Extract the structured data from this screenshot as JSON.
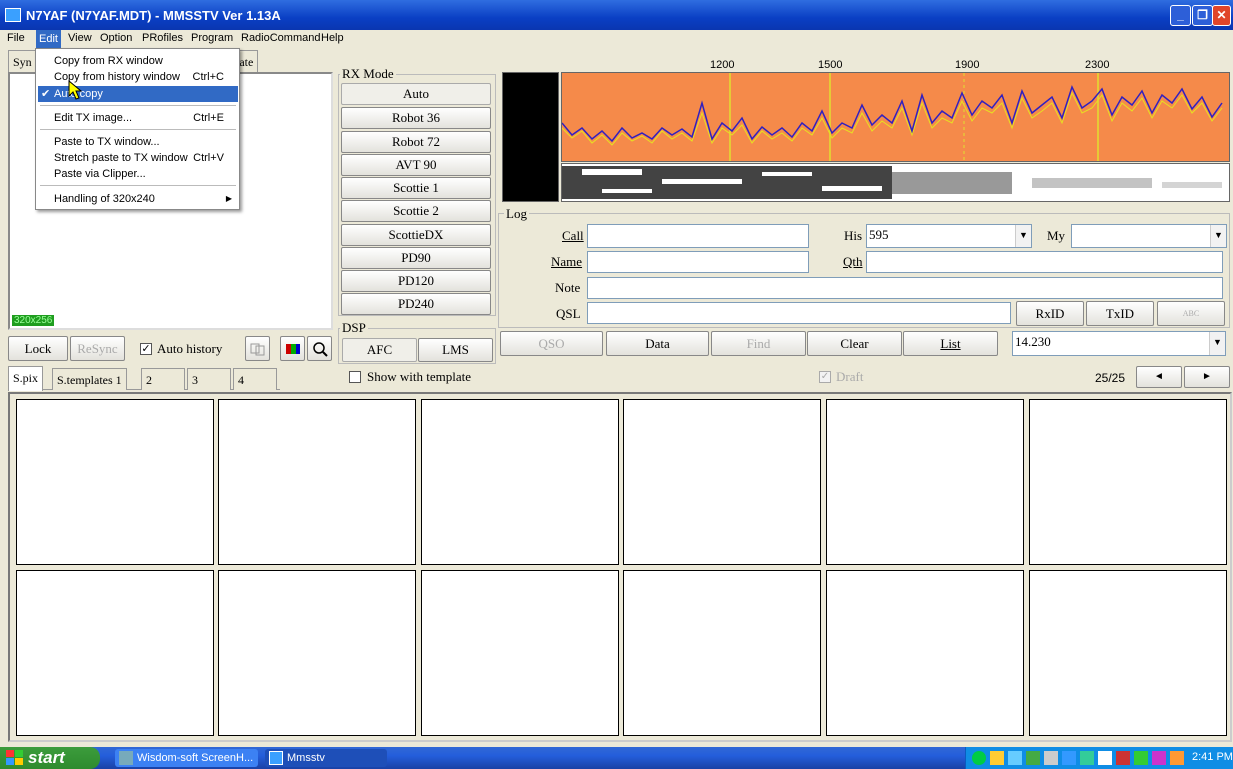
{
  "window": {
    "title": "N7YAF (N7YAF.MDT) - MMSSTV Ver 1.13A"
  },
  "menubar": [
    "File",
    "Edit",
    "View",
    "Option",
    "PRofiles",
    "Program",
    "RadioCommand",
    "Help"
  ],
  "edit_menu": {
    "items": [
      {
        "label": "Copy from RX window",
        "shortcut": ""
      },
      {
        "label": "Copy from history window",
        "shortcut": "Ctrl+C"
      },
      {
        "label": "Auto copy",
        "shortcut": "",
        "checked": true
      },
      {
        "label": "Edit TX image...",
        "shortcut": "Ctrl+E"
      },
      {
        "label": "Paste to TX window...",
        "shortcut": ""
      },
      {
        "label": "Stretch paste to TX window",
        "shortcut": "Ctrl+V"
      },
      {
        "label": "Paste via Clipper...",
        "shortcut": ""
      },
      {
        "label": "Handling of 320x240",
        "shortcut": "",
        "submenu": true
      }
    ],
    "checkmark": "✔",
    "submenu_arrow": "▶"
  },
  "top_tabs": {
    "first": "Syn",
    "second": "late"
  },
  "rx_panel": {
    "size_badge": "320x256"
  },
  "rx_controls": {
    "lock": "Lock",
    "resync": "ReSync",
    "auto_history": "Auto history",
    "auto_history_checked": true,
    "check_glyph": "✓"
  },
  "rx_mode": {
    "label": "RX Mode",
    "modes": [
      "Auto",
      "Robot 36",
      "Robot 72",
      "AVT 90",
      "Scottie 1",
      "Scottie 2",
      "ScottieDX",
      "PD90",
      "PD120",
      "PD240"
    ]
  },
  "dsp": {
    "label": "DSP",
    "afc": "AFC",
    "lms": "LMS"
  },
  "spectrum": {
    "freq_labels": [
      "1200",
      "1500",
      "1900",
      "2300"
    ],
    "bg_color": "#f58a4a"
  },
  "log": {
    "label": "Log",
    "call_label": "Call",
    "call_value": "",
    "his_label": "His",
    "his_value": "595",
    "my_label": "My",
    "my_value": "",
    "name_label": "Name",
    "name_value": "",
    "qth_label": "Qth",
    "qth_value": "",
    "note_label": "Note",
    "note_value": "",
    "qsl_label": "QSL",
    "qsl_value": "",
    "rxid": "RxID",
    "txid": "TxID",
    "abc_icon": "ABC"
  },
  "log_buttons": {
    "qso": "QSO",
    "data": "Data",
    "find": "Find",
    "clear": "Clear",
    "list": "List",
    "freq": "14.230"
  },
  "bottom_tabs": [
    "S.pix",
    "S.templates 1",
    "2",
    "3",
    "4"
  ],
  "show_with_template": "Show with template",
  "draft": "Draft",
  "pager": {
    "count": "25/25",
    "prev": "◄",
    "next": "►"
  },
  "taskbar": {
    "start": "start",
    "tasks": [
      "Wisdom-soft ScreenH...",
      "Mmsstv"
    ],
    "clock": "2:41 PM"
  }
}
